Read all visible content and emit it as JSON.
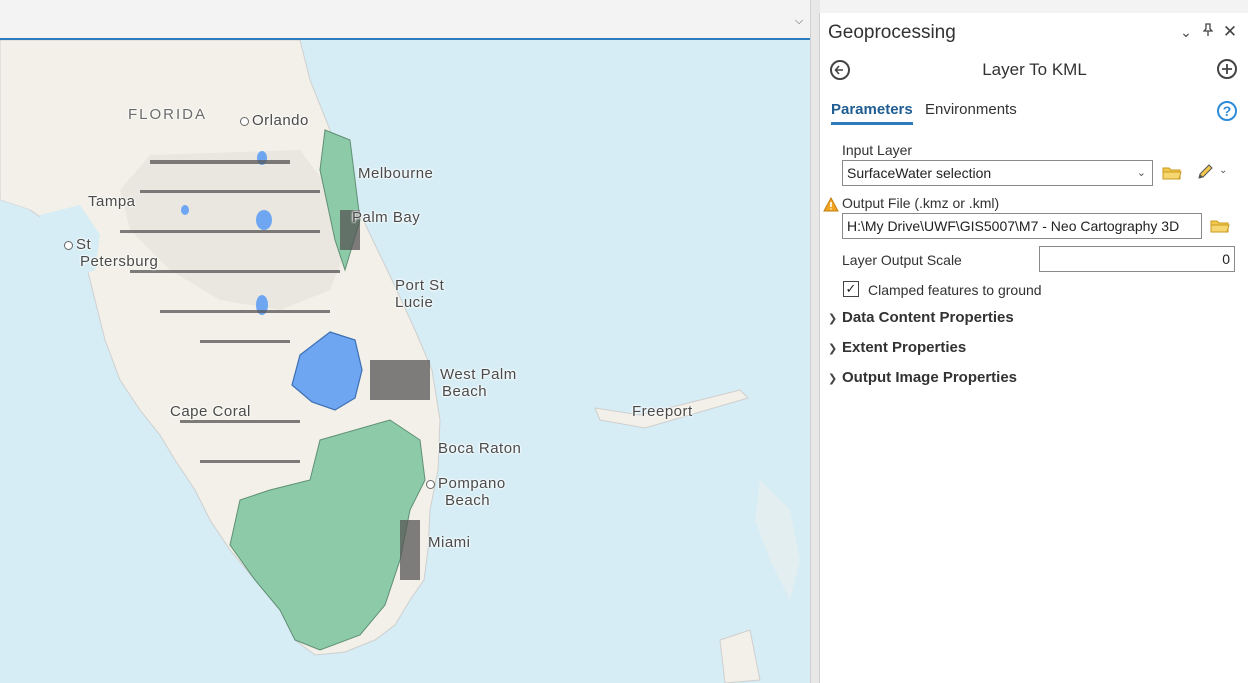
{
  "map": {
    "labels": {
      "florida": "FLORIDA",
      "orlando": "Orlando",
      "melbourne": "Melbourne",
      "tampa": "Tampa",
      "palm_bay": "Palm Bay",
      "st_petersburg_1": "St",
      "st_petersburg_2": "Petersburg",
      "port_st_lucie_1": "Port St",
      "port_st_lucie_2": "Lucie",
      "west_palm_beach_1": "West Palm",
      "west_palm_beach_2": "Beach",
      "cape_coral": "Cape Coral",
      "freeport": "Freeport",
      "boca_raton": "Boca Raton",
      "pompano_beach_1": "Pompano",
      "pompano_beach_2": "Beach",
      "miami": "Miami"
    },
    "colors": {
      "water": "#d6edf5",
      "land": "#f2f0e8",
      "wetland": "#8ccaa8",
      "lake": "#6ea6f2",
      "selection": "#555555"
    }
  },
  "gp": {
    "pane_title": "Geoprocessing",
    "tool_title": "Layer To KML",
    "tabs": {
      "parameters": "Parameters",
      "environments": "Environments"
    },
    "help_glyph": "?",
    "input_layer": {
      "label": "Input Layer",
      "value": "SurfaceWater selection"
    },
    "output_file": {
      "label": "Output File (.kmz or .kml)",
      "value": "H:\\My Drive\\UWF\\GIS5007\\M7 - Neo Cartography 3D"
    },
    "output_scale": {
      "label": "Layer Output Scale",
      "value": "0"
    },
    "clamped": {
      "label": "Clamped features to ground",
      "checked": true
    },
    "sections": [
      "Data Content Properties",
      "Extent Properties",
      "Output Image Properties"
    ]
  }
}
